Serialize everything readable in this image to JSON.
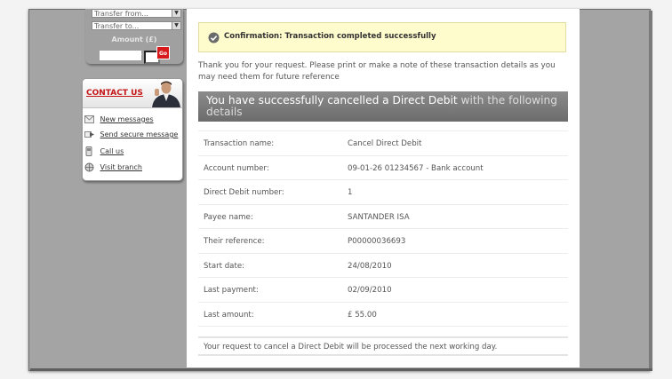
{
  "transfer": {
    "from_value": "Transfer from...",
    "to_value": "Transfer to...",
    "amount_label": "Amount (£)",
    "decimal": ".",
    "go_label": "Go"
  },
  "contact": {
    "title": "CONTACT US",
    "links": [
      {
        "label": "New messages",
        "icon": "envelope-icon"
      },
      {
        "label": "Send secure message",
        "icon": "send-message-icon"
      },
      {
        "label": "Call us",
        "icon": "phone-icon"
      },
      {
        "label": "Visit branch",
        "icon": "globe-icon"
      }
    ]
  },
  "confirmation": {
    "text": "Confirmation: Transaction completed successfully",
    "icon": "check-circle-icon"
  },
  "thanks": "Thank you for your request. Please print or make a note of these transaction details as you may need them for future reference",
  "banner": {
    "main": "You have successfully cancelled a Direct Debit",
    "rest": " with the following details"
  },
  "details": [
    {
      "label": "Transaction name:",
      "value": "Cancel Direct Debit"
    },
    {
      "label": "Account number:",
      "value": "09-01-26 01234567 - Bank account"
    },
    {
      "label": "Direct Debit number:",
      "value": "1"
    },
    {
      "label": "Payee name:",
      "value": "SANTANDER ISA"
    },
    {
      "label": "Their reference:",
      "value": "P00000036693"
    },
    {
      "label": "Start date:",
      "value": "24/08/2010"
    },
    {
      "label": "Last payment:",
      "value": "02/09/2010"
    },
    {
      "label": "Last amount:",
      "value": "£ 55.00"
    }
  ],
  "note": "Your request to cancel a Direct Debit will be processed the next working day.",
  "colors": {
    "brand_red": "#d8191c",
    "confirm_bg": "#fefbcc",
    "banner_bg": "#7a7a7a"
  }
}
